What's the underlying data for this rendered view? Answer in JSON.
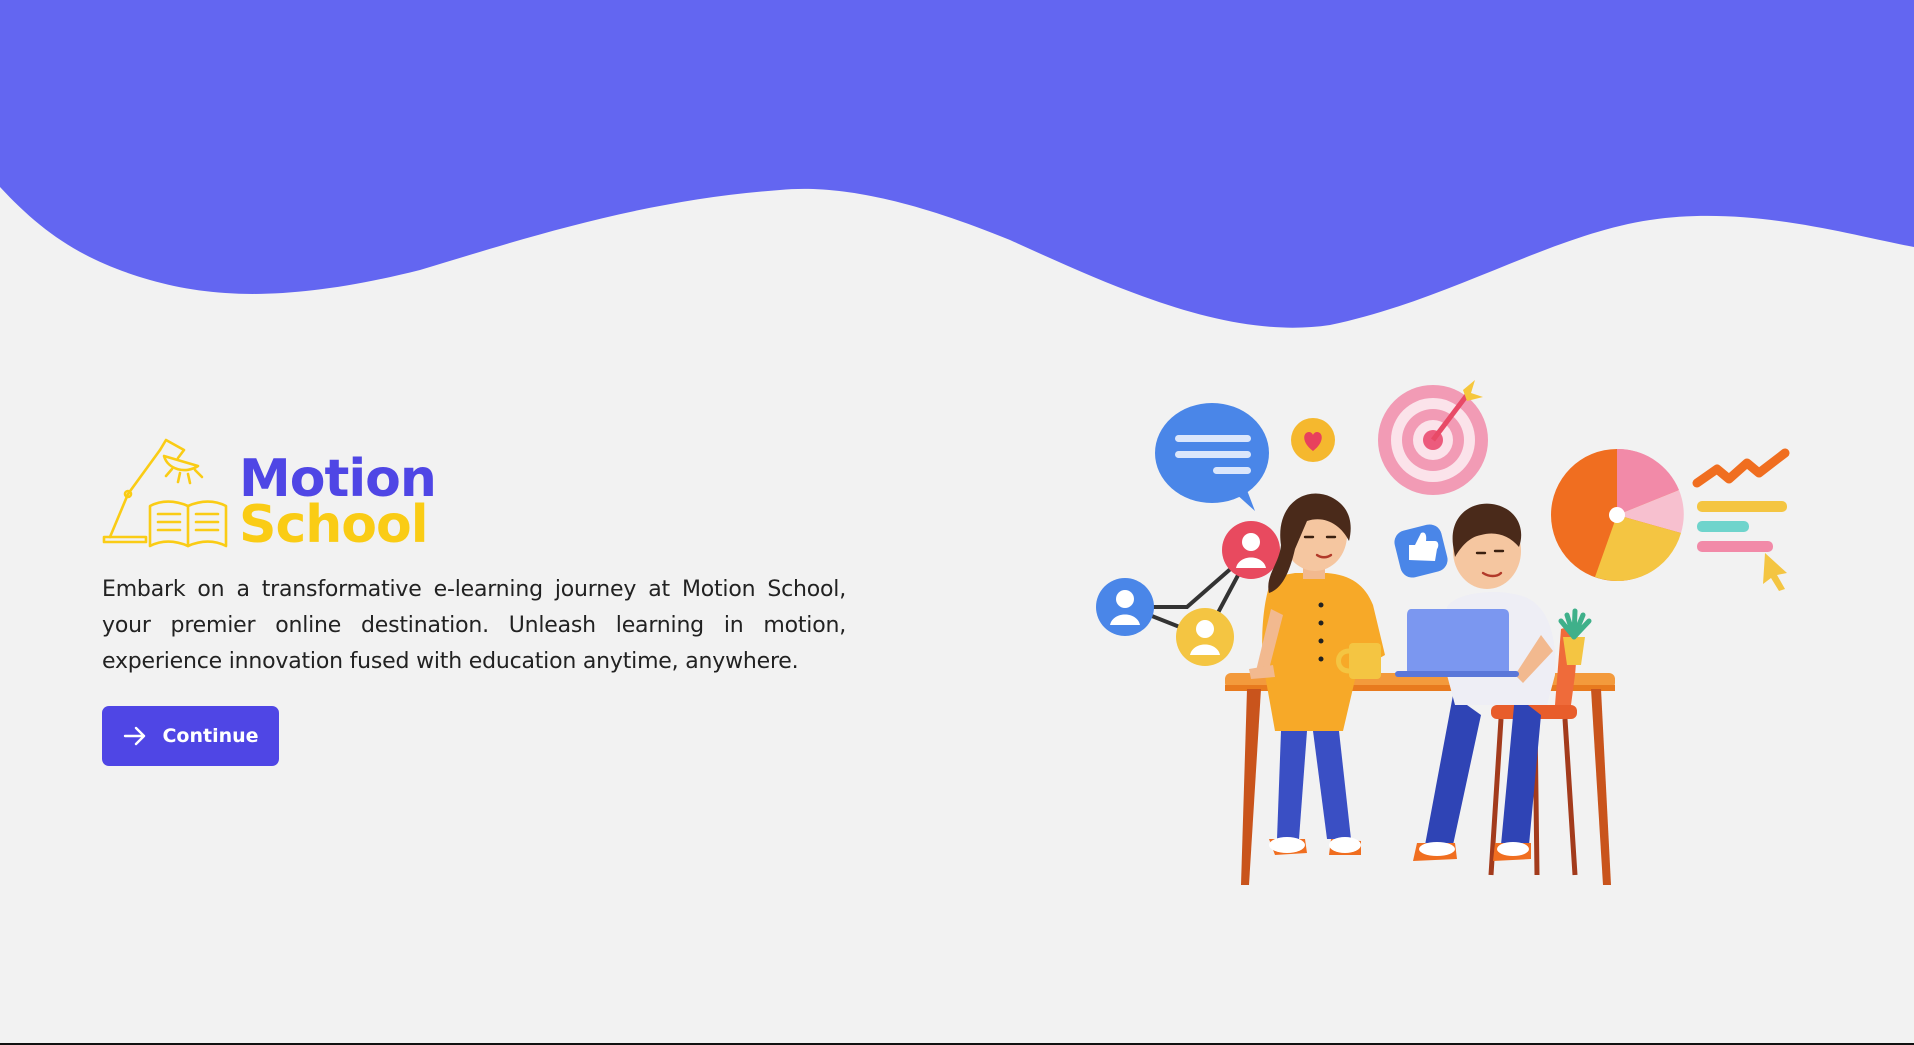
{
  "brand": {
    "name_line1": "Motion",
    "name_line2": "School",
    "colors": {
      "primary": "#4f46e5",
      "accent": "#facc15",
      "wave": "#6366f1",
      "background": "#f2f2f2"
    },
    "icon": "lamp-and-open-book-icon"
  },
  "hero": {
    "description": "Embark on a transformative e-learning journey at Motion School, your premier online destination. Unleash learning in motion, experience innovation fused with education anytime, anywhere.",
    "button_label": "Continue",
    "button_icon": "arrow-right-icon",
    "illustration": "people-working-at-desk-illustration"
  }
}
